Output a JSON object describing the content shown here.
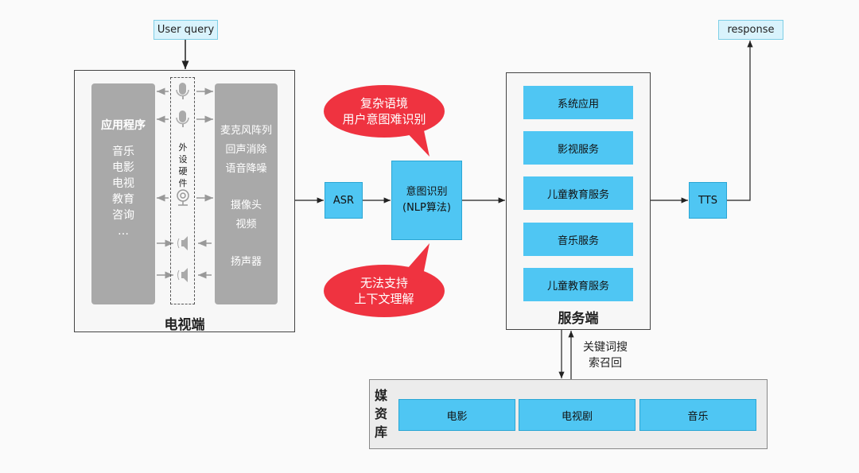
{
  "input": {
    "label": "User query"
  },
  "output": {
    "label": "response"
  },
  "tv": {
    "title": "电视端",
    "apps": {
      "heading": "应用程序",
      "items": [
        "音乐",
        "电影",
        "电视",
        "教育",
        "咨询",
        "…"
      ]
    },
    "hardware": {
      "label": "外设硬件",
      "icons": [
        "microphone-icon",
        "microphone-icon",
        "camera-icon",
        "speaker-icon",
        "speaker-icon"
      ]
    },
    "capabilities": {
      "mic": [
        "麦克风阵列",
        "回声消除",
        "语音降噪"
      ],
      "camera": [
        "摄像头",
        "视频"
      ],
      "speaker": [
        "扬声器"
      ]
    }
  },
  "asr": {
    "label": "ASR"
  },
  "nlp": {
    "line1": "意图识别",
    "line2": "(NLP算法)"
  },
  "bubbles": {
    "top": [
      "复杂语境",
      "用户意图难识别"
    ],
    "bottom": [
      "无法支持",
      "上下文理解"
    ]
  },
  "server": {
    "title": "服务端",
    "services": [
      "系统应用",
      "影视服务",
      "儿童教育服务",
      "音乐服务",
      "儿童教育服务"
    ]
  },
  "tts": {
    "label": "TTS"
  },
  "search_label": [
    "关键词搜",
    "索召回"
  ],
  "media": {
    "title": "媒资库",
    "items": [
      "电影",
      "电视剧",
      "音乐"
    ]
  },
  "colors": {
    "blue": "#4fc6f3",
    "red": "#ef3340",
    "gray": "#a9a9a9"
  }
}
